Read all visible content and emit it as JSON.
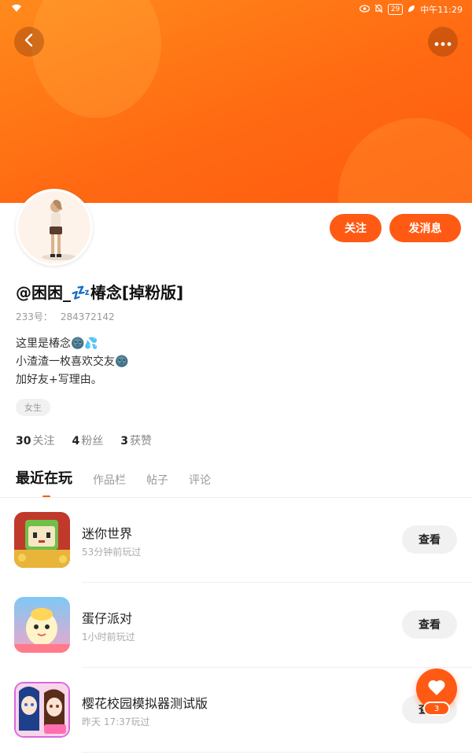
{
  "status_bar": {
    "time": "中午11:29",
    "battery": "29",
    "icons": [
      "wifi-icon",
      "eye-icon",
      "mute-icon",
      "battery-icon",
      "leaf-icon"
    ]
  },
  "header": {
    "back_icon": "back-arrow-icon",
    "more_icon": "more-dots-icon"
  },
  "profile": {
    "nickname": "@困困_💤椿念[掉粉版]",
    "id_label": "233号：",
    "id_value": "284372142",
    "bio": [
      "这里是椿念🌚💦",
      "小渣渣一枚喜欢交友🌚",
      "加好友+写理由。"
    ],
    "gender_tag": "女生",
    "follow_label": "关注",
    "message_label": "发消息"
  },
  "stats": [
    {
      "count": "30",
      "label": "关注"
    },
    {
      "count": "4",
      "label": "粉丝"
    },
    {
      "count": "3",
      "label": "获赞"
    }
  ],
  "tabs": [
    {
      "label": "最近在玩",
      "active": true
    },
    {
      "label": "作品栏",
      "active": false
    },
    {
      "label": "帖子",
      "active": false
    },
    {
      "label": "评论",
      "active": false
    }
  ],
  "games": [
    {
      "name": "迷你世界",
      "time": "53分钟前玩过",
      "button": "查看"
    },
    {
      "name": "蛋仔派对",
      "time": "1小时前玩过",
      "button": "查看"
    },
    {
      "name": "樱花校园模拟器测试版",
      "time": "昨天 17:37玩过",
      "button": "查看"
    }
  ],
  "fab": {
    "icon": "heart-icon",
    "count": "3"
  },
  "colors": {
    "accent": "#ff5a14",
    "banner_start": "#ff8a1c",
    "banner_end": "#ff5a10"
  }
}
